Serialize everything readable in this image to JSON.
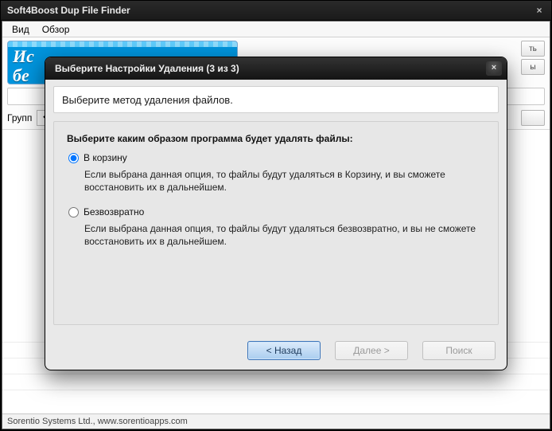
{
  "app": {
    "title": "Soft4Boost Dup File Finder",
    "close_glyph": "×"
  },
  "menu": {
    "items": [
      "Вид",
      "Обзор"
    ]
  },
  "banner": {
    "line1": "Ис",
    "line2": "бе"
  },
  "side_buttons": {
    "b1": "ть",
    "b2": "ы"
  },
  "grouping": {
    "label": "Групп",
    "value": ""
  },
  "status": {
    "text": "Sorentio Systems Ltd.,  www.sorentioapps.com"
  },
  "dialog": {
    "title": "Выберите Настройки Удаления (3 из 3)",
    "close_glyph": "×",
    "instruction": "Выберите метод удаления файлов.",
    "heading": "Выберите каким образом программа будет удалять файлы:",
    "options": [
      {
        "label": "В корзину",
        "desc": "Если выбрана данная опция, то файлы будут удаляться в Корзину, и вы сможете восстановить их в дальнейшем.",
        "checked": true
      },
      {
        "label": "Безвозвратно",
        "desc": "Если выбрана данная опция, то файлы будут удаляться безвозвратно, и вы не сможете восстановить их в дальнейшем.",
        "checked": false
      }
    ],
    "buttons": {
      "back": "< Назад",
      "next": "Далее >",
      "search": "Поиск"
    }
  }
}
